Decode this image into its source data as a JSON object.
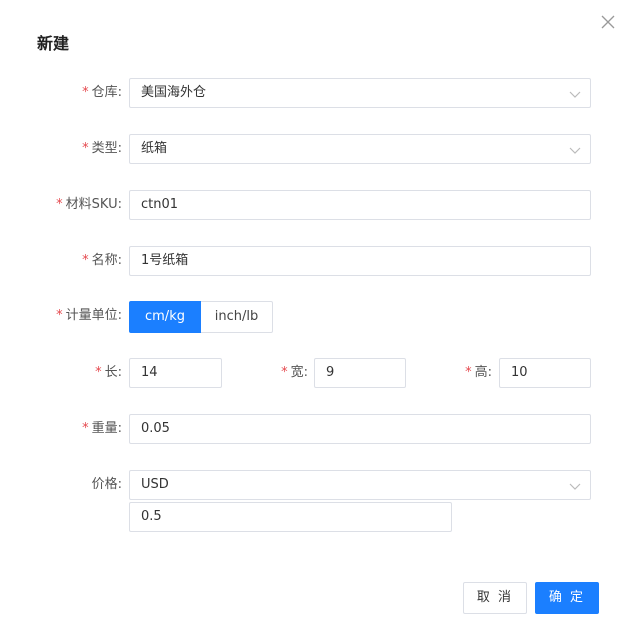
{
  "dialog": {
    "title": "新建"
  },
  "form": {
    "warehouse": {
      "label": "仓库:",
      "value": "美国海外仓"
    },
    "type": {
      "label": "类型:",
      "value": "纸箱"
    },
    "sku": {
      "label": "材料SKU:",
      "value": "ctn01"
    },
    "name": {
      "label": "名称:",
      "value": "1号纸箱"
    },
    "unit": {
      "label": "计量单位:",
      "options": [
        "cm/kg",
        "inch/lb"
      ],
      "selected": "cm/kg"
    },
    "length": {
      "label": "长:",
      "value": "14"
    },
    "width": {
      "label": "宽:",
      "value": "9"
    },
    "height": {
      "label": "高:",
      "value": "10"
    },
    "weight": {
      "label": "重量:",
      "value": "0.05"
    },
    "price": {
      "label": "价格:",
      "currency": "USD",
      "value": "0.5"
    },
    "required_mark": "*"
  },
  "footer": {
    "cancel_label": "取 消",
    "ok_label": "确 定"
  },
  "colors": {
    "accent": "#1b7fff",
    "required": "#e5484d",
    "border": "#dcdfe6"
  }
}
